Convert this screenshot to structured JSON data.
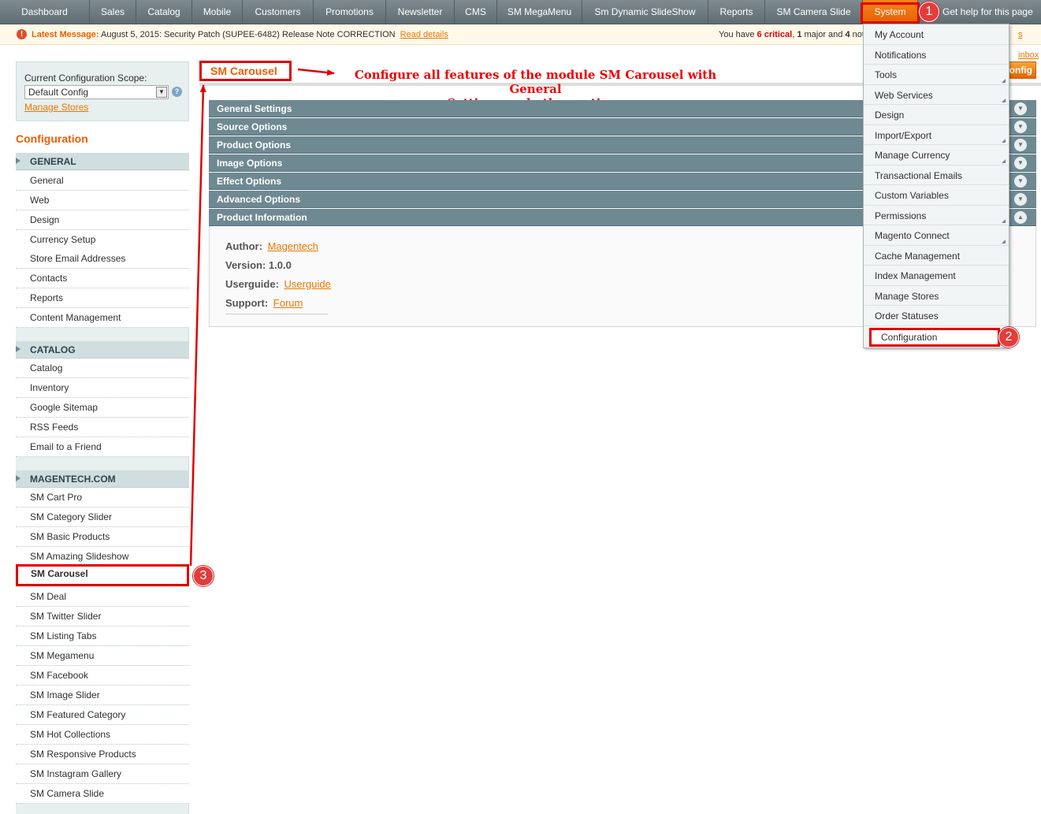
{
  "topnav": {
    "items": [
      {
        "label": "Dashboard"
      },
      {
        "label": "Sales"
      },
      {
        "label": "Catalog"
      },
      {
        "label": "Mobile"
      },
      {
        "label": "Customers"
      },
      {
        "label": "Promotions"
      },
      {
        "label": "Newsletter"
      },
      {
        "label": "CMS"
      },
      {
        "label": "SM MegaMenu"
      },
      {
        "label": "Sm Dynamic SlideShow"
      },
      {
        "label": "Reports"
      },
      {
        "label": "SM Camera Slide"
      },
      {
        "label": "System"
      }
    ],
    "help": "Get help for this page"
  },
  "message": {
    "prefix": "Latest Message:",
    "text": "August 5, 2015: Security Patch (SUPEE-6482) Release Note CORRECTION",
    "link": "Read details",
    "right_pre": "You have",
    "critical": "6 critical",
    "major": "1",
    "major_text": "major and",
    "minor": "4",
    "minor_text": "noti",
    "inbox": "s inbox"
  },
  "scope": {
    "label": "Current Configuration Scope:",
    "value": "Default Config",
    "manage": "Manage Stores"
  },
  "sidebar": {
    "title": "Configuration",
    "groups": [
      {
        "title": "GENERAL",
        "items": [
          "General",
          "Web",
          "Design",
          "Currency Setup",
          "Store Email Addresses",
          "Contacts",
          "Reports",
          "Content Management"
        ]
      },
      {
        "title": "CATALOG",
        "items": [
          "Catalog",
          "Inventory",
          "Google Sitemap",
          "RSS Feeds",
          "Email to a Friend"
        ]
      },
      {
        "title": "MAGENTECH.COM",
        "items": [
          "SM Cart Pro",
          "SM Category Slider",
          "SM Basic Products",
          "SM Amazing Slideshow",
          "SM Carousel",
          "SM Deal",
          "SM Twitter Slider",
          "SM Listing Tabs",
          "SM Megamenu",
          "SM Facebook",
          "SM Image Slider",
          "SM Featured Category",
          "SM Hot Collections",
          "SM Responsive Products",
          "SM Instagram Gallery",
          "SM Camera Slide"
        ]
      }
    ],
    "active": "SM Carousel"
  },
  "main": {
    "title": "SM Carousel",
    "annotation_line1": "Configure all features of the module SM Carousel with General",
    "annotation_line2": "Settings and other options",
    "save_button": "onfig",
    "sections": [
      "General Settings",
      "Source Options",
      "Product Options",
      "Image Options",
      "Effect Options",
      "Advanced Options",
      "Product Information"
    ],
    "info": {
      "author_label": "Author:",
      "author_link": "Magentech",
      "version_label": "Version:",
      "version_value": "1.0.0",
      "guide_label": "Userguide:",
      "guide_link": "Userguide",
      "support_label": "Support:",
      "support_link": "Forum"
    }
  },
  "dropdown": {
    "items": [
      {
        "label": "My Account",
        "sub": false
      },
      {
        "label": "Notifications",
        "sub": false
      },
      {
        "label": "Tools",
        "sub": true
      },
      {
        "label": "Web Services",
        "sub": true
      },
      {
        "label": "Design",
        "sub": false
      },
      {
        "label": "Import/Export",
        "sub": true
      },
      {
        "label": "Manage Currency",
        "sub": true
      },
      {
        "label": "Transactional Emails",
        "sub": false
      },
      {
        "label": "Custom Variables",
        "sub": false
      },
      {
        "label": "Permissions",
        "sub": true
      },
      {
        "label": "Magento Connect",
        "sub": true
      },
      {
        "label": "Cache Management",
        "sub": false
      },
      {
        "label": "Index Management",
        "sub": false
      },
      {
        "label": "Manage Stores",
        "sub": false
      },
      {
        "label": "Order Statuses",
        "sub": false
      },
      {
        "label": "Configuration",
        "sub": false
      }
    ]
  },
  "badges": [
    "1",
    "2",
    "3"
  ],
  "colors": {
    "accent": "#eb5e00",
    "nav": "#6b797f",
    "section_header": "#6f8992",
    "annotation": "#ea0000"
  }
}
